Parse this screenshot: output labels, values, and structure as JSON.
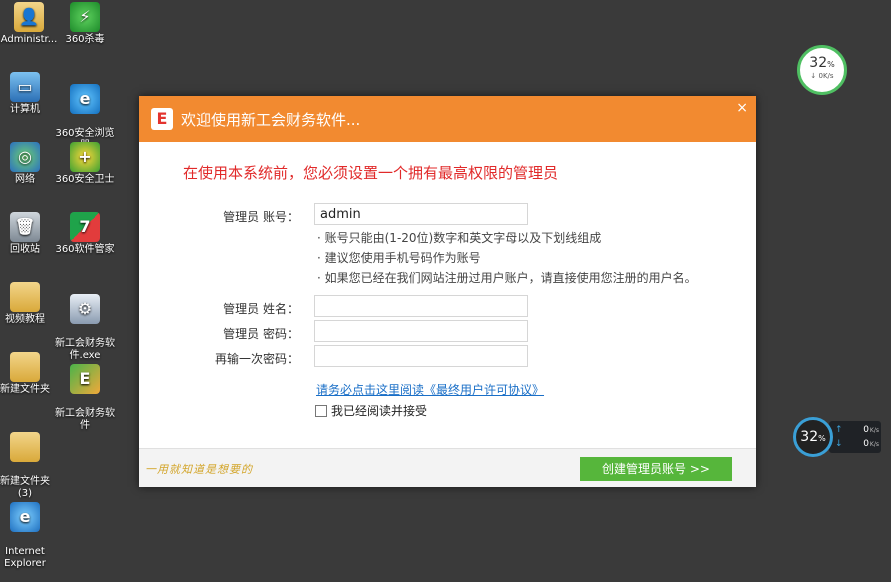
{
  "desktop": {
    "col1": [
      {
        "label": "Administr...",
        "icon": "user-folder-icon"
      },
      {
        "label": "计算机",
        "icon": "computer-icon"
      },
      {
        "label": "网络",
        "icon": "network-icon"
      },
      {
        "label": "回收站",
        "icon": "recycle-bin-icon"
      },
      {
        "label": "视频教程",
        "icon": "folder-icon"
      },
      {
        "label": "新建文件夹",
        "icon": "folder-icon"
      },
      {
        "label": "新建文件夹\n(3)",
        "icon": "folder-icon"
      },
      {
        "label": "Internet\nExplorer",
        "icon": "ie-icon"
      }
    ],
    "col2": [
      {
        "label": "360杀毒",
        "icon": "360-antivirus-icon"
      },
      {
        "label": "360安全浏览\n器",
        "icon": "360-browser-icon"
      },
      {
        "label": "360安全卫士",
        "icon": "360-security-icon"
      },
      {
        "label": "360软件管家",
        "icon": "360-software-icon"
      },
      {
        "label": "新工会财务软\n件.exe",
        "icon": "installer-icon"
      },
      {
        "label": "新工会财务软\n件",
        "icon": "app-icon"
      }
    ]
  },
  "dialog": {
    "title": "欢迎使用新工会财务软件...",
    "logo_glyph": "E",
    "close": "×",
    "headline": "在使用本系统前，您必须设置一个拥有最高权限的管理员",
    "account_label": "管理员  账号：",
    "account_value": "admin",
    "hints": [
      "· 账号只能由(1-20位)数字和英文字母以及下划线组成",
      "· 建议您使用手机号码作为账号",
      "· 如果您已经在我们网站注册过用户账户，请直接使用您注册的用户名。"
    ],
    "name_label": "管理员  姓名：",
    "password_label": "管理员  密码：",
    "confirm_label": "再输一次密码：",
    "license_link": "请务必点击这里阅读《最终用户许可协议》",
    "agree_label": "我已经阅读并接受",
    "slogan": "一用就知道是想要的",
    "create_button": "创建管理员账号 >>"
  },
  "widgets": {
    "top_pct": "32",
    "top_pct_unit": "%",
    "top_speed": "↓ 0K/s",
    "bottom_pct": "32",
    "bottom_pct_unit": "%",
    "up_value": "0",
    "down_value": "0",
    "speed_unit": "K/s",
    "up_arrow": "↑",
    "down_arrow": "↓"
  },
  "colors": {
    "titlebar": "#f28a30",
    "headline": "#e12a2a",
    "button": "#56b63b",
    "link": "#1a6fc7"
  }
}
